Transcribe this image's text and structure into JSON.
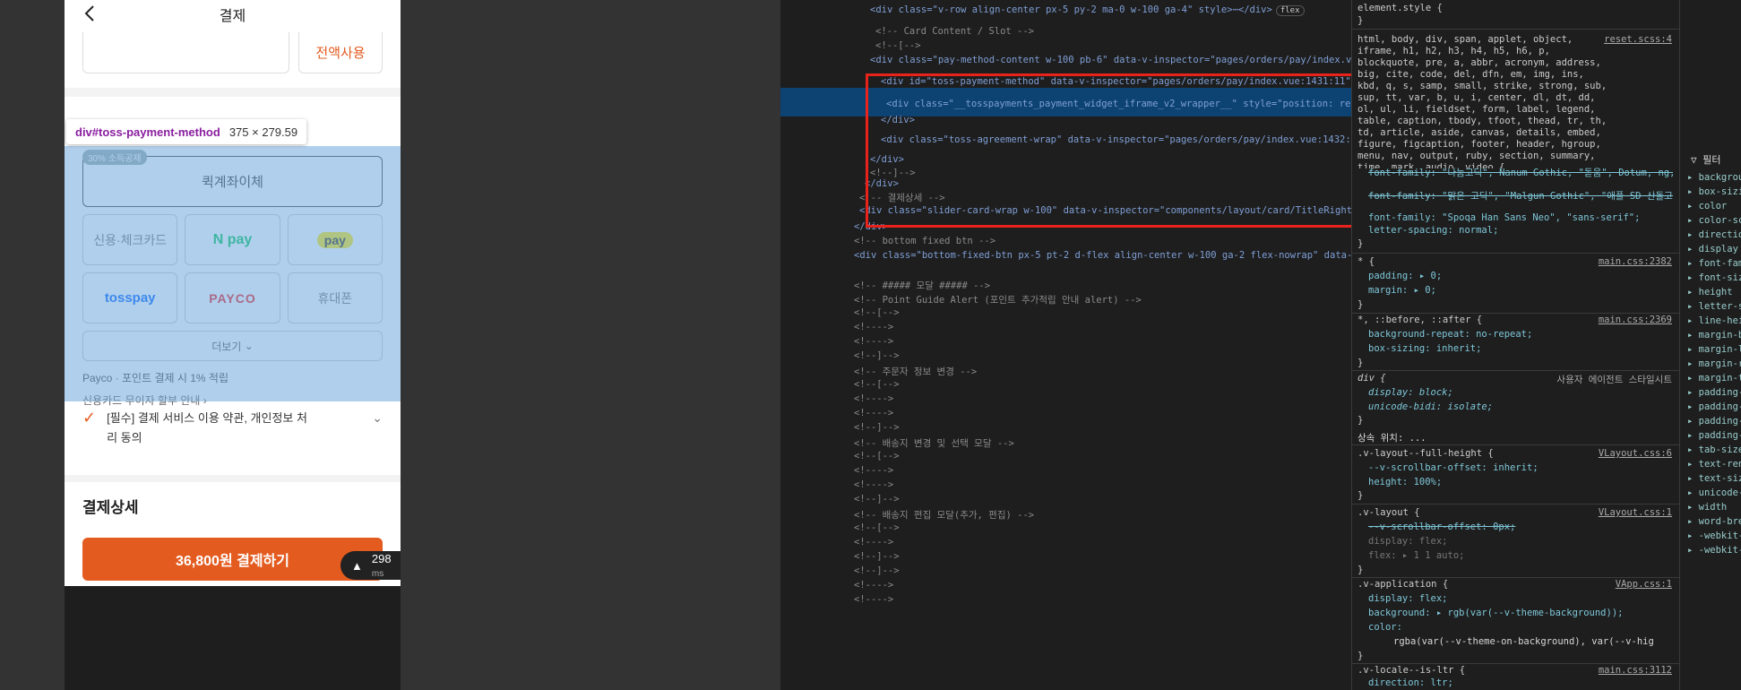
{
  "mobile": {
    "title": "결제",
    "coupon_button": "전액사용",
    "inspector_tooltip": {
      "selector_tag": "div",
      "selector_id": "#toss-payment-method",
      "dimensions": "375 × 279.59"
    },
    "badge": "30% 소득공제",
    "quick_transfer": "퀵계좌이체",
    "methods": [
      "신용·체크카드",
      "N pay",
      "pay",
      "tosspay",
      "PAYCO",
      "휴대폰"
    ],
    "more": "더보기",
    "payco_info": "Payco · 포인트 결제 시 1% 적립",
    "card_info": "신용카드 무이자 할부 안내 ›",
    "agreement": "[필수] 결제 서비스 이용 약관, 개인정보 처리 동의",
    "detail_title": "결제상세",
    "pay_button": "36,800원 결제하기",
    "timing": "298",
    "timing_unit": "ms"
  },
  "elements": [
    {
      "t": "<div class=\"v-row align-center px-5 py-2 ma-0 w-100 ga-4\" style>⋯</div>",
      "badge": "flex"
    },
    {
      "t": "<!-- Card Content / Slot -->"
    },
    {
      "t": "<!--[-->"
    },
    {
      "t": "<div class=\"pay-method-content w-100 pb-6\" data-v-inspector=\"pages/orders/pay/index.vue:1430:9\" data-v-295b2697>"
    },
    {
      "t": "<div id=\"toss-payment-method\" data-v-inspector=\"pages/orders/pay/index.vue:1431:11\" data-v-295b2697> == $0"
    },
    {
      "t": "<div class=\"__tosspayments_payment_widget_iframe_v2_wrapper__\" style=\"position: relative; width: 100%; height: auto;\">⋯</div>"
    },
    {
      "t": "</div>"
    },
    {
      "t": "<div class=\"toss-agreement-wrap\" data-v-inspector=\"pages/orders/pay/index.vue:1432:11\" data-v-295b2697>⋯</div>"
    },
    {
      "t": "</div>"
    },
    {
      "t": "<!--]-->"
    },
    {
      "t": "</div>"
    },
    {
      "t": "<!-- 결제상세 -->"
    },
    {
      "t": "<div class=\"slider-card-wrap w-100\" data-v-inspector=\"components/layout/card/TitleRightSlotCard.vue:24:3\" data-v-295b2697>⋯</div>"
    },
    {
      "t": "</div>"
    },
    {
      "t": "<!-- bottom fixed btn -->"
    },
    {
      "t": "<div class=\"bottom-fixed-btn px-5 pt-2 d-flex align-center w-100 ga-2 flex-nowrap\" data-v-inspector=\"components/layout/BottomFixedBtn.vue:47:3\" data-v-295b2697 data-v-52e07841>⋯</div>",
      "badge": "flex"
    },
    {
      "t": "<!-- ##### 모달 ##### -->"
    },
    {
      "t": "<!-- Point Guide Alert (포인트 추가적립 안내 alert) -->"
    },
    {
      "t": "<!--[-->"
    },
    {
      "t": "<!---->"
    },
    {
      "t": "<!---->"
    },
    {
      "t": "<!--]-->"
    },
    {
      "t": "<!-- 주문자 정보 변경 -->"
    },
    {
      "t": "<!--[-->"
    },
    {
      "t": "<!---->"
    },
    {
      "t": "<!---->"
    },
    {
      "t": "<!--]-->"
    },
    {
      "t": "<!-- 배송지 변경 및 선택 모달 -->"
    },
    {
      "t": "<!--[-->"
    },
    {
      "t": "<!---->"
    },
    {
      "t": "<!---->"
    },
    {
      "t": "<!--]-->"
    },
    {
      "t": "<!-- 배송지 편집 모달(추가, 편집) -->"
    },
    {
      "t": "<!--[-->"
    },
    {
      "t": "<!---->"
    },
    {
      "t": "<!--]-->"
    },
    {
      "t": "<!--]-->"
    },
    {
      "t": "<!---->"
    },
    {
      "t": "<!---->"
    }
  ],
  "styles": {
    "element_style": "element.style {",
    "reset_selector": "html, body, div, span, applet, object, iframe, h1, h2, h3, h4, h5, h6, p, blockquote, pre, a, abbr, acronym, address, big, cite, code, del, dfn, em, img, ins, kbd, q, s, samp, small, strike, strong, sub, sup, tt, var, b, u, i, center, dl, dt, dd, ol, ul, li, fieldset, form, label, legend, table, caption, tbody, tfoot, thead, tr, th, td, article, aside, canvas, details, embed, figure, figcaption, footer, header, hgroup, menu, nav, output, ruby, section, summary, time, mark, audio, video {",
    "reset_src": "reset.scss:4",
    "ff1": "font-family: \"나눔고딕\", Nanum Gothic, \"돋움\", Dotum, ng, sans-serif;",
    "ff2": "font-family: \"맑은 고딕\", \"Malgun Gothic\", \"애플 SD 산돌고딕 Neo\", \"Apple SD Gothic Neo\", sans-serif;",
    "ff3": "font-family: \"Spoqa Han Sans Neo\", \"sans-serif\";",
    "ls": "letter-spacing: normal;",
    "star": "* {",
    "star_src": "main.css:2382",
    "padding": "padding: ▸ 0;",
    "margin": "margin: ▸ 0;",
    "pseudo": "*, ::before, ::after {",
    "pseudo_src": "main.css:2369",
    "bg_repeat": "background-repeat: no-repeat;",
    "box_sizing": "box-sizing: inherit;",
    "div_rule": "div {",
    "ua": "사용자 에이전트 스타일시트",
    "display_block": "display: block;",
    "unicode_bidi": "unicode-bidi: isolate;",
    "inherited": "상속 위치: ...",
    "vlayout_full": ".v-layout--full-height {",
    "vlayout_full_src": "VLayout.css:6",
    "scrollbar": "--v-scrollbar-offset: inherit;",
    "height100": "height: 100%;",
    "vlayout": ".v-layout {",
    "vlayout_src": "VLayout.css:1",
    "scrollbar_px": "--v-scrollbar-offset: 0px;",
    "display_flex": "display: flex;",
    "flex": "flex: ▸ 1 1 auto;",
    "vapp": ".v-application {",
    "vapp_src": "VApp.css:1",
    "vapp_display": "display: flex;",
    "vapp_bg": "background: ▸ rgb(var(--v-theme-background));",
    "vapp_color": "color:",
    "vapp_color_val": "rgba(var(--v-theme-on-background), var(--v-hig",
    "vlocale": ".v-locale--is-ltr {",
    "vlocale_src": "main.css:3112",
    "direction": "direction: ltr;"
  },
  "computed": {
    "filter": "▽ 필터",
    "items": [
      "backgrou",
      "box-sizi",
      "color",
      "color-sc",
      "directio",
      "display",
      "font-fam",
      "font-siz",
      "height",
      "letter-s",
      "line-hei",
      "margin-b",
      "margin-l",
      "margin-r",
      "margin-t",
      "padding-",
      "padding-",
      "padding-",
      "padding-",
      "tab-size",
      "text-ren",
      "text-siz",
      "unicode-",
      "width",
      "word-bre",
      "-webkit-",
      "-webkit-"
    ]
  }
}
